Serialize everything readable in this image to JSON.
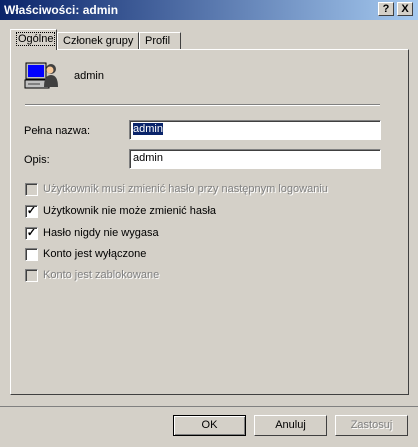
{
  "window": {
    "title": "Właściwości: admin",
    "help_label": "?",
    "close_label": "X"
  },
  "tabs": [
    {
      "label": "Ogólne",
      "active": true
    },
    {
      "label": "Członek grupy",
      "active": false
    },
    {
      "label": "Profil",
      "active": false
    }
  ],
  "user": {
    "name": "admin",
    "icon": "user-computer-icon"
  },
  "form": {
    "full_name_label": "Pełna nazwa:",
    "full_name_value": "admin",
    "description_label": "Opis:",
    "description_value": "admin"
  },
  "options": [
    {
      "label": "Użytkownik musi zmienić hasło przy następnym logowaniu",
      "checked": false,
      "enabled": false
    },
    {
      "label": "Użytkownik nie może zmienić hasła",
      "checked": true,
      "enabled": true
    },
    {
      "label": "Hasło nigdy nie wygasa",
      "checked": true,
      "enabled": true
    },
    {
      "label": "Konto jest wyłączone",
      "checked": false,
      "enabled": true
    },
    {
      "label": "Konto jest zablokowane",
      "checked": false,
      "enabled": false
    }
  ],
  "buttons": {
    "ok": "OK",
    "cancel": "Anuluj",
    "apply": "Zastosuj"
  },
  "colors": {
    "dialog_bg": "#d4d0c8",
    "titlebar_start": "#0a246a",
    "titlebar_end": "#a6caf0",
    "selection": "#0a246a"
  }
}
